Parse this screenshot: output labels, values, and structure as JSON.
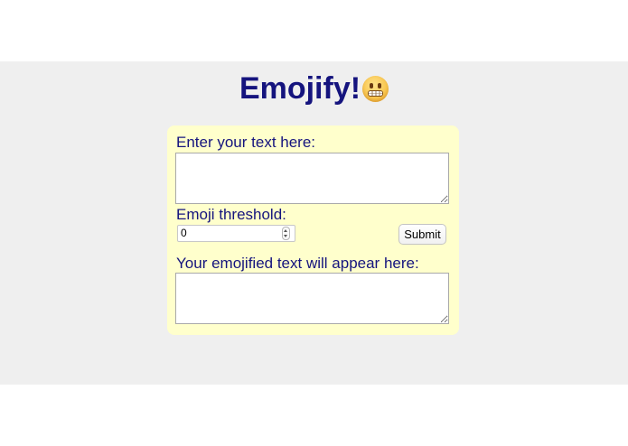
{
  "header": {
    "title": "Emojify!",
    "title_emoji_icon": "grimacing-face-icon"
  },
  "form": {
    "input_label": "Enter your text here:",
    "input_value": "",
    "threshold_label": "Emoji threshold:",
    "threshold_value": "0",
    "submit_label": "Submit",
    "output_label": "Your emojified text will appear here:",
    "output_value": ""
  },
  "colors": {
    "title_text": "#15147e",
    "label_text": "#15147e",
    "card_background": "#ffffcc",
    "band_background": "#efefef",
    "page_background": "#ffffff"
  }
}
